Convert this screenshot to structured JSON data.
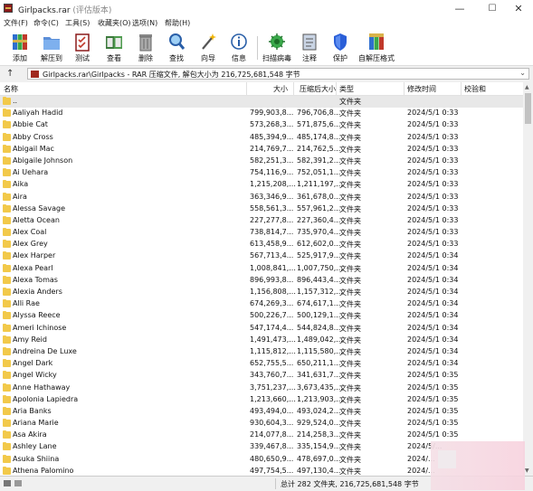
{
  "window": {
    "title": "Girlpacks.rar",
    "title_suffix": "(评估版本)",
    "controls": {
      "minimize": "—",
      "maximize": "☐",
      "close": "✕"
    }
  },
  "menu": [
    "文件(F)",
    "命令(C)",
    "工具(S)",
    "收藏夹(O)",
    "选项(N)",
    "帮助(H)"
  ],
  "toolbar": [
    {
      "label": "添加",
      "icon": "add-archive-icon"
    },
    {
      "label": "解压到",
      "icon": "extract-folder-icon"
    },
    {
      "label": "测试",
      "icon": "test-clipboard-icon"
    },
    {
      "label": "查看",
      "icon": "view-book-icon"
    },
    {
      "label": "删除",
      "icon": "trash-icon"
    },
    {
      "label": "查找",
      "icon": "magnifier-icon"
    },
    {
      "label": "向导",
      "icon": "wizard-wand-icon"
    },
    {
      "label": "信息",
      "icon": "info-icon"
    },
    {
      "label": "扫描病毒",
      "icon": "virus-scan-icon"
    },
    {
      "label": "注释",
      "icon": "comment-icon"
    },
    {
      "label": "保护",
      "icon": "shield-icon"
    },
    {
      "label": "自解压格式",
      "icon": "sfx-archive-icon"
    }
  ],
  "address": {
    "text": "Girlpacks.rar\\Girlpacks - RAR 压缩文件, 解包大小为 216,725,681,548 字节"
  },
  "columns": {
    "name": "名称",
    "size": "大小",
    "packed": "压缩后大小",
    "type": "类型",
    "modified": "修改时间",
    "crc": "校验和"
  },
  "rows": [
    {
      "name": "..",
      "size": "",
      "packed": "",
      "type": "文件夹",
      "modified": ""
    },
    {
      "name": "Aaliyah Hadid",
      "size": "799,903,8...",
      "packed": "796,706,8...",
      "type": "文件夹",
      "modified": "2024/5/1 0:33"
    },
    {
      "name": "Abbie Cat",
      "size": "573,268,3...",
      "packed": "571,875,6...",
      "type": "文件夹",
      "modified": "2024/5/1 0:33"
    },
    {
      "name": "Abby Cross",
      "size": "485,394,9...",
      "packed": "485,174,8...",
      "type": "文件夹",
      "modified": "2024/5/1 0:33"
    },
    {
      "name": "Abigail Mac",
      "size": "214,769,7...",
      "packed": "214,762,5...",
      "type": "文件夹",
      "modified": "2024/5/1 0:33"
    },
    {
      "name": "Abigaile Johnson",
      "size": "582,251,3...",
      "packed": "582,391,2...",
      "type": "文件夹",
      "modified": "2024/5/1 0:33"
    },
    {
      "name": "Ai Uehara",
      "size": "754,116,9...",
      "packed": "752,051,1...",
      "type": "文件夹",
      "modified": "2024/5/1 0:33"
    },
    {
      "name": "Aika",
      "size": "1,215,208,...",
      "packed": "1,211,197,...",
      "type": "文件夹",
      "modified": "2024/5/1 0:33"
    },
    {
      "name": "Aira",
      "size": "363,346,9...",
      "packed": "361,678,0...",
      "type": "文件夹",
      "modified": "2024/5/1 0:33"
    },
    {
      "name": "Alessa Savage",
      "size": "558,561,3...",
      "packed": "557,961,2...",
      "type": "文件夹",
      "modified": "2024/5/1 0:33"
    },
    {
      "name": "Aletta Ocean",
      "size": "227,277,8...",
      "packed": "227,360,4...",
      "type": "文件夹",
      "modified": "2024/5/1 0:33"
    },
    {
      "name": "Alex Coal",
      "size": "738,814,7...",
      "packed": "735,970,4...",
      "type": "文件夹",
      "modified": "2024/5/1 0:33"
    },
    {
      "name": "Alex Grey",
      "size": "613,458,9...",
      "packed": "612,602,0...",
      "type": "文件夹",
      "modified": "2024/5/1 0:33"
    },
    {
      "name": "Alex Harper",
      "size": "567,713,4...",
      "packed": "525,917,9...",
      "type": "文件夹",
      "modified": "2024/5/1 0:34"
    },
    {
      "name": "Alexa Pearl",
      "size": "1,008,841,...",
      "packed": "1,007,750,...",
      "type": "文件夹",
      "modified": "2024/5/1 0:34"
    },
    {
      "name": "Alexa Tomas",
      "size": "896,993,8...",
      "packed": "896,443,4...",
      "type": "文件夹",
      "modified": "2024/5/1 0:34"
    },
    {
      "name": "Alexia Anders",
      "size": "1,156,808,...",
      "packed": "1,157,312,...",
      "type": "文件夹",
      "modified": "2024/5/1 0:34"
    },
    {
      "name": "Alli Rae",
      "size": "674,269,3...",
      "packed": "674,617,1...",
      "type": "文件夹",
      "modified": "2024/5/1 0:34"
    },
    {
      "name": "Alyssa Reece",
      "size": "500,226,7...",
      "packed": "500,129,1...",
      "type": "文件夹",
      "modified": "2024/5/1 0:34"
    },
    {
      "name": "Ameri Ichinose",
      "size": "547,174,4...",
      "packed": "544,824,8...",
      "type": "文件夹",
      "modified": "2024/5/1 0:34"
    },
    {
      "name": "Amy Reid",
      "size": "1,491,473,...",
      "packed": "1,489,042,...",
      "type": "文件夹",
      "modified": "2024/5/1 0:34"
    },
    {
      "name": "Andreina De Luxe",
      "size": "1,115,812,...",
      "packed": "1,115,580,...",
      "type": "文件夹",
      "modified": "2024/5/1 0:34"
    },
    {
      "name": "Angel Dark",
      "size": "652,755,5...",
      "packed": "650,211,1...",
      "type": "文件夹",
      "modified": "2024/5/1 0:34"
    },
    {
      "name": "Angel Wicky",
      "size": "343,760,7...",
      "packed": "341,631,7...",
      "type": "文件夹",
      "modified": "2024/5/1 0:35"
    },
    {
      "name": "Anne Hathaway",
      "size": "3,751,237,...",
      "packed": "3,673,435,...",
      "type": "文件夹",
      "modified": "2024/5/1 0:35"
    },
    {
      "name": "Apolonia Lapiedra",
      "size": "1,213,660,...",
      "packed": "1,213,903,...",
      "type": "文件夹",
      "modified": "2024/5/1 0:35"
    },
    {
      "name": "Aria Banks",
      "size": "493,494,0...",
      "packed": "493,024,2...",
      "type": "文件夹",
      "modified": "2024/5/1 0:35"
    },
    {
      "name": "Ariana Marie",
      "size": "930,604,3...",
      "packed": "929,524,0...",
      "type": "文件夹",
      "modified": "2024/5/1 0:35"
    },
    {
      "name": "Asa Akira",
      "size": "214,077,8...",
      "packed": "214,258,3...",
      "type": "文件夹",
      "modified": "2024/5/1 0:35"
    },
    {
      "name": "Ashley Lane",
      "size": "339,467,8...",
      "packed": "335,154,9...",
      "type": "文件夹",
      "modified": "2024/5/..."
    },
    {
      "name": "Asuka Shiina",
      "size": "480,650,9...",
      "packed": "478,697,0...",
      "type": "文件夹",
      "modified": "2024/..."
    },
    {
      "name": "Athena Palomino",
      "size": "497,754,5...",
      "packed": "497,130,4...",
      "type": "文件夹",
      "modified": "2024/..."
    }
  ],
  "status": {
    "text": "总计 282 文件夹, 216,725,681,548 字节"
  },
  "colors": {
    "folder": "#f2c94a",
    "archive_red": "#8b1a1a"
  }
}
